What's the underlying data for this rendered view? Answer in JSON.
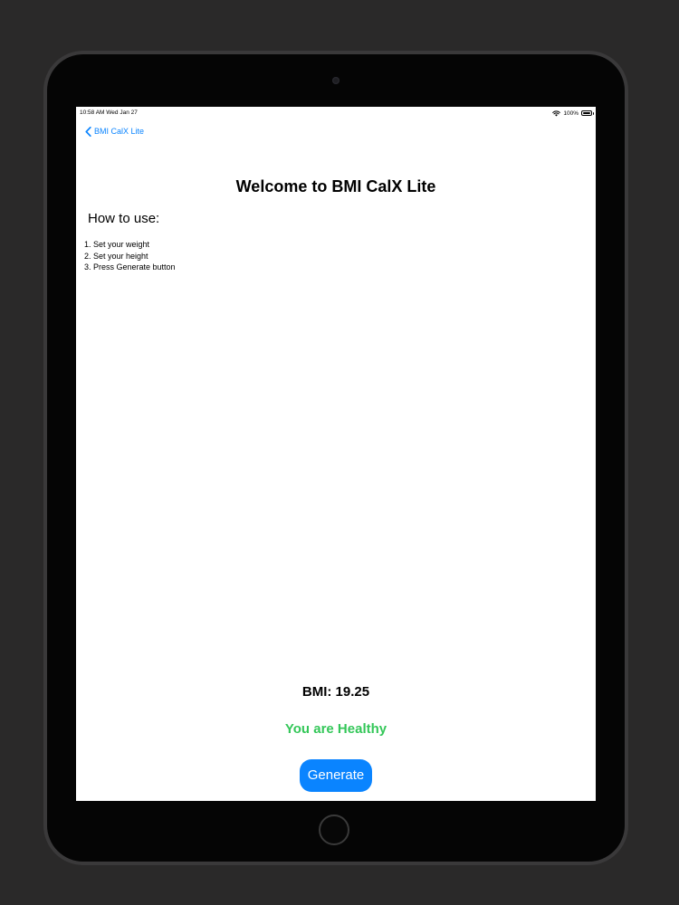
{
  "status_bar": {
    "time_date": "10:58 AM   Wed Jan 27",
    "battery": "100%",
    "wifi_icon": "wifi-icon",
    "battery_icon": "battery-icon"
  },
  "nav": {
    "back_label": "BMI CalX Lite",
    "back_icon": "chevron-left-icon"
  },
  "main": {
    "title": "Welcome to BMI CalX Lite",
    "how_to_heading": "How to use:",
    "steps": [
      "1. Set your weight",
      "2. Set your height",
      "3. Press Generate button"
    ],
    "bmi_text": "BMI: 19.25",
    "status_text": "You are Healthy",
    "generate_label": "Generate"
  },
  "colors": {
    "accent": "#0a84ff",
    "healthy": "#34c759",
    "background": "#ffffff",
    "device_frame": "#050505",
    "backdrop": "#2a2929"
  }
}
